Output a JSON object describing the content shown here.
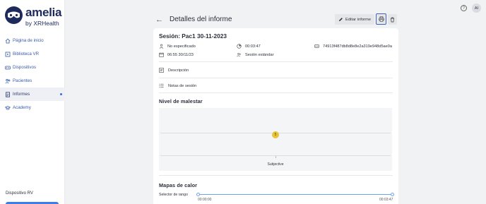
{
  "brand": {
    "name": "amelia",
    "sub": "by XRHealth"
  },
  "sidebar": {
    "items": [
      {
        "label": "Página de inicio",
        "icon": "home-icon"
      },
      {
        "label": "Biblioteca VR",
        "icon": "library-icon"
      },
      {
        "label": "Dispositivos",
        "icon": "vr-headset-icon"
      },
      {
        "label": "Pacientes",
        "icon": "patients-icon"
      },
      {
        "label": "Informes",
        "icon": "reports-icon",
        "active": true
      },
      {
        "label": "Academy",
        "icon": "academy-icon"
      }
    ],
    "device_label": "Dispositivo RV"
  },
  "topbar": {
    "avatar": "AI"
  },
  "header": {
    "title": "Detalles del informe",
    "edit_label": "Editar informe"
  },
  "session": {
    "title": "Sesión: Pac1 30-11-2023",
    "therapist": "No especificado",
    "duration": "00:03:47",
    "device_id": "74913f487db8d8e8e2a319e948d5ae0a",
    "datetime": "06:55 30/11/23",
    "session_type": "Sesión estándar"
  },
  "rows": {
    "description": "Descripción",
    "notes": "Notas de sesión"
  },
  "discomfort": {
    "title": "Nivel de malestar"
  },
  "chart_data": {
    "type": "scatter",
    "categories": [
      "Subjective"
    ],
    "values": [
      5
    ],
    "title": "Nivel de malestar",
    "data_labels": [
      "5"
    ]
  },
  "heatmaps": {
    "title": "Mapas de calor",
    "range_label": "Selector de rango",
    "range_start": "00:00:00",
    "range_end": "00:03:47"
  },
  "colors": {
    "accent": "#3d64c4",
    "point": "#e6c53a",
    "brand": "#1f2a5c"
  }
}
